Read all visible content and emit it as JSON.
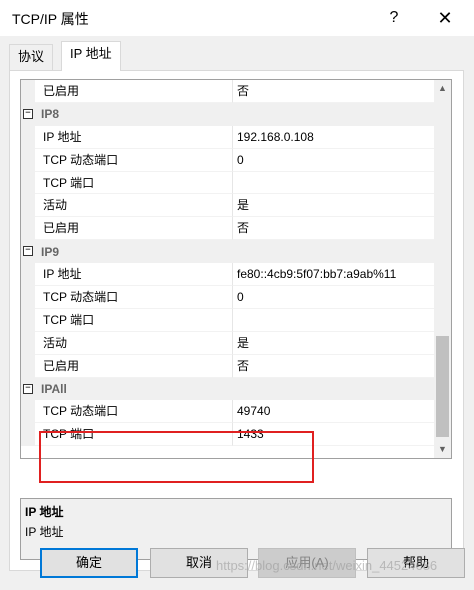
{
  "window": {
    "title": "TCP/IP 属性",
    "help_glyph": "?",
    "close_glyph": "✕"
  },
  "tabs": [
    {
      "label": "协议"
    },
    {
      "label": "IP 地址"
    }
  ],
  "grid": {
    "rows": [
      {
        "type": "prop",
        "name": "已启用",
        "value": "否"
      },
      {
        "type": "category",
        "name": "IP8"
      },
      {
        "type": "prop",
        "name": "IP 地址",
        "value": "192.168.0.108"
      },
      {
        "type": "prop",
        "name": "TCP 动态端口",
        "value": "0"
      },
      {
        "type": "prop",
        "name": "TCP 端口",
        "value": ""
      },
      {
        "type": "prop",
        "name": "活动",
        "value": "是"
      },
      {
        "type": "prop",
        "name": "已启用",
        "value": "否"
      },
      {
        "type": "category",
        "name": "IP9"
      },
      {
        "type": "prop",
        "name": "IP 地址",
        "value": "fe80::4cb9:5f07:bb7:a9ab%11"
      },
      {
        "type": "prop",
        "name": "TCP 动态端口",
        "value": "0"
      },
      {
        "type": "prop",
        "name": "TCP 端口",
        "value": ""
      },
      {
        "type": "prop",
        "name": "活动",
        "value": "是"
      },
      {
        "type": "prop",
        "name": "已启用",
        "value": "否"
      },
      {
        "type": "category",
        "name": "IPAll"
      },
      {
        "type": "prop",
        "name": "TCP 动态端口",
        "value": "49740"
      },
      {
        "type": "prop",
        "name": "TCP 端口",
        "value": "1433"
      }
    ],
    "expander_glyph": "−"
  },
  "description": {
    "title": "IP 地址",
    "text": "IP 地址"
  },
  "buttons": {
    "ok": "确定",
    "cancel": "取消",
    "apply": "应用(A)",
    "help": "帮助"
  },
  "watermark": "https://blog.csdn.net/weixin_44524686",
  "colors": {
    "highlight": "#e02020",
    "focus": "#0078d7"
  }
}
